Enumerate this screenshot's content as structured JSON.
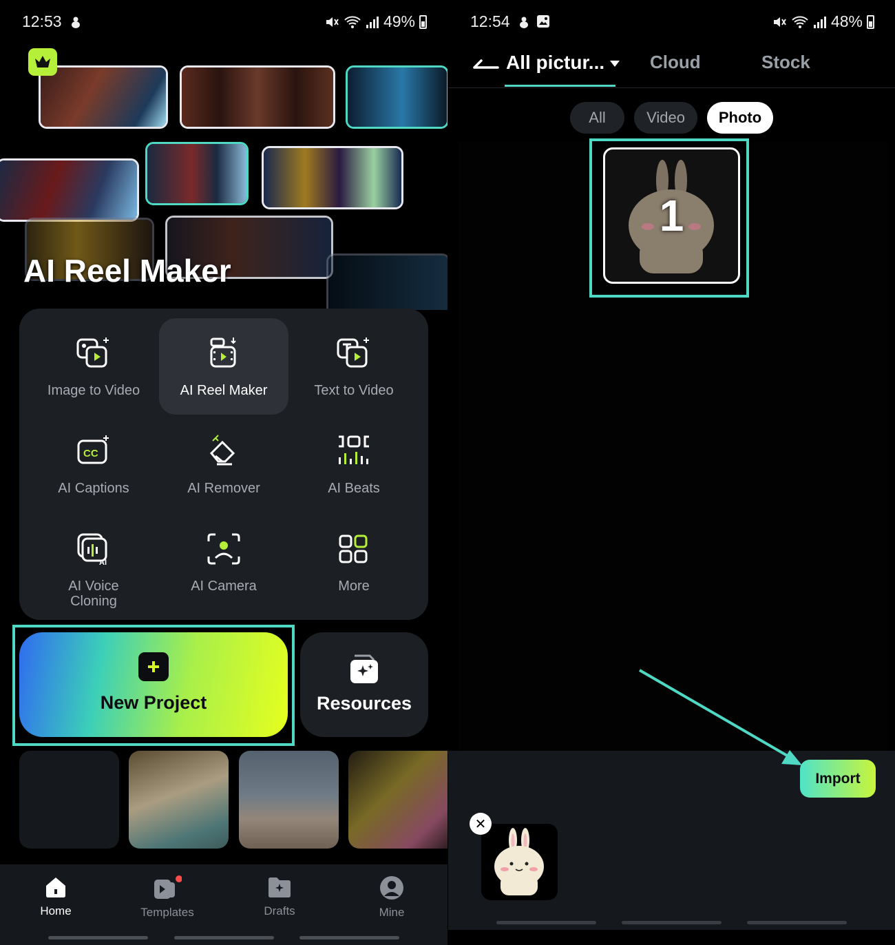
{
  "left": {
    "status": {
      "time": "12:53",
      "battery": "49%"
    },
    "banner": {
      "title": "AI Reel Maker"
    },
    "tools": [
      {
        "label": "Image to Video",
        "icon": "image-to-video-icon"
      },
      {
        "label": "AI Reel Maker",
        "icon": "ai-reel-maker-icon",
        "active": true
      },
      {
        "label": "Text to Video",
        "icon": "text-to-video-icon"
      },
      {
        "label": "AI Captions",
        "icon": "ai-captions-icon"
      },
      {
        "label": "AI Remover",
        "icon": "ai-remover-icon"
      },
      {
        "label": "AI Beats",
        "icon": "ai-beats-icon"
      },
      {
        "label": "AI Voice Cloning",
        "icon": "ai-voice-cloning-icon"
      },
      {
        "label": "AI Camera",
        "icon": "ai-camera-icon"
      },
      {
        "label": "More",
        "icon": "more-grid-icon"
      }
    ],
    "new_project": "New Project",
    "resources": "Resources",
    "nav": [
      {
        "label": "Home",
        "icon": "home-icon",
        "active": true
      },
      {
        "label": "Templates",
        "icon": "templates-icon"
      },
      {
        "label": "Drafts",
        "icon": "drafts-icon"
      },
      {
        "label": "Mine",
        "icon": "profile-icon"
      }
    ]
  },
  "right": {
    "status": {
      "time": "12:54",
      "battery": "48%"
    },
    "tabs": [
      {
        "label": "All pictur...",
        "active": true
      },
      {
        "label": "Cloud"
      },
      {
        "label": "Stock"
      }
    ],
    "filters": [
      {
        "label": "All"
      },
      {
        "label": "Video"
      },
      {
        "label": "Photo",
        "active": true
      }
    ],
    "selected_number": "1",
    "import_label": "Import"
  },
  "colors": {
    "accent": "#4fd8c4",
    "lime": "#d8f52a",
    "panel": "#1c1f24"
  }
}
